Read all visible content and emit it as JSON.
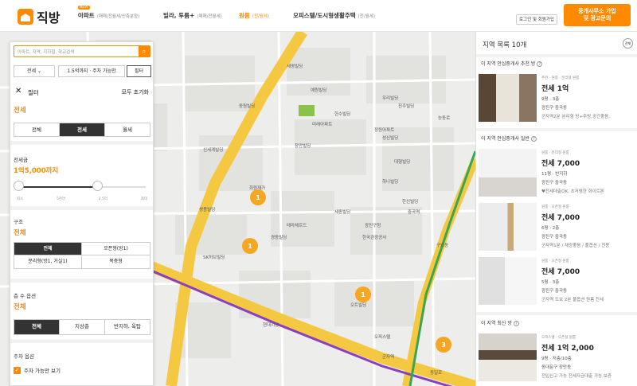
{
  "header": {
    "logo_text": "직방",
    "nav": [
      {
        "label": "아파트",
        "sub": "(매매/전월세/신축분양)",
        "badge": "NEW",
        "active": false
      },
      {
        "label": "빌라, 투룸+",
        "sub": "(매매/전월세)",
        "active": false
      },
      {
        "label": "원룸",
        "sub": "(전/월세)",
        "active": true
      },
      {
        "label": "오피스텔/도시형생활주택",
        "sub": "(전/월세)",
        "active": false
      }
    ],
    "login_label": "로그인 및 회원가입",
    "cta_label_1": "중개사무소 가입",
    "cta_label_2": "및 광고문의"
  },
  "filter_panel": {
    "search_placeholder": "아파트, 지역, 지하철, 학교검색",
    "deal_select": "전세",
    "price_select": "1.5억까지 · 주차 가능만",
    "filter_btn": "필터",
    "title": "필터",
    "reset_label": "모두 초기화",
    "deal_type": {
      "value": "전세",
      "options": [
        "전체",
        "전세",
        "월세"
      ],
      "selected": 1
    },
    "deposit": {
      "label": "전세금",
      "value": "1억5,000까지",
      "ticks": [
        "최소",
        "5천만",
        "2.5억",
        "최대"
      ],
      "level": 0.62
    },
    "structure": {
      "label": "구조",
      "value": "전체",
      "options": [
        "전체",
        "오픈형(방1)",
        "분리형(방1, 거실1)",
        "복층형"
      ],
      "selected": 0
    },
    "floor": {
      "label": "층 수 옵션",
      "value": "전체",
      "options": [
        "전체",
        "지상층",
        "반지하, 옥탑"
      ],
      "selected": 0
    },
    "parking": {
      "label": "주차 옵션",
      "check_label": "주차 가능만 보기"
    }
  },
  "map": {
    "clusters": [
      "1",
      "1",
      "1",
      "3"
    ],
    "labels": [
      "세명빌딩",
      "동원빌딩",
      "한수빌딩",
      "진주빌딩",
      "예원빌딩",
      "미래아파트",
      "정원아파트",
      "성신빌딩",
      "장안빌딩",
      "한국관광공사",
      "우리빌딩",
      "대형빌딩",
      "테라체르드",
      "한신빌딩",
      "광진구청",
      "능동로",
      "중곡역",
      "구의동",
      "쌍용빌딩",
      "경동빌딩",
      "회원재가",
      "오트빌딩",
      "세종빌딩",
      "군자역",
      "현대시장",
      "SK허브빌딩",
      "신세계빌딩",
      "오피스텔",
      "하나빌딩",
      "동일로"
    ]
  },
  "listing": {
    "title": "지역 목록 10개",
    "count_btn": "전체",
    "sections": [
      {
        "title": "이 지역 안심중개사 추천 방"
      },
      {
        "title": "이 지역 안심중개사 일반"
      },
      {
        "title": "이 지역 최신 방"
      }
    ],
    "cards": [
      {
        "tags": "추천 · 원룸 · 분리형 원룸",
        "price": "전세 1억",
        "meta": "9평 · 3층",
        "addr": "광진구 중곡동",
        "desc": "군자역2분 분리형 방+주방,공간좋음,"
      },
      {
        "tags": "원룸 · 분리형 원룸",
        "price": "전세 7,000",
        "meta": "11평 · 반지하",
        "addr": "광진구 중곡동",
        "desc": "♥전세대출OK, 초저렴한 화이트톤"
      },
      {
        "tags": "원룸 · 오픈형 원룸",
        "price": "전세 7,000",
        "meta": "6평 · 2층",
        "addr": "광진구 중곡동",
        "desc": "군자역1분 / 채광좋음 / 풀옵션 / 전용"
      },
      {
        "tags": "원룸 · 오픈형 원룸",
        "price": "전세 7,000",
        "meta": "5평 · 3층",
        "addr": "광진구 중곡동",
        "desc": "군자역 도보 2분 풀옵션 원룸 전세"
      },
      {
        "tags": "오피스텔 · 오픈형 원룸",
        "price": "전세 1억 2,000",
        "meta": "9평 · 저층/10층",
        "addr": "동대문구 장안동",
        "desc": "전입신고 가능 전세자금대출 가능 보증"
      }
    ]
  },
  "colors": {
    "accent": "#ff8a00",
    "road": "#f5c842",
    "subway": "#8a3fc0"
  }
}
